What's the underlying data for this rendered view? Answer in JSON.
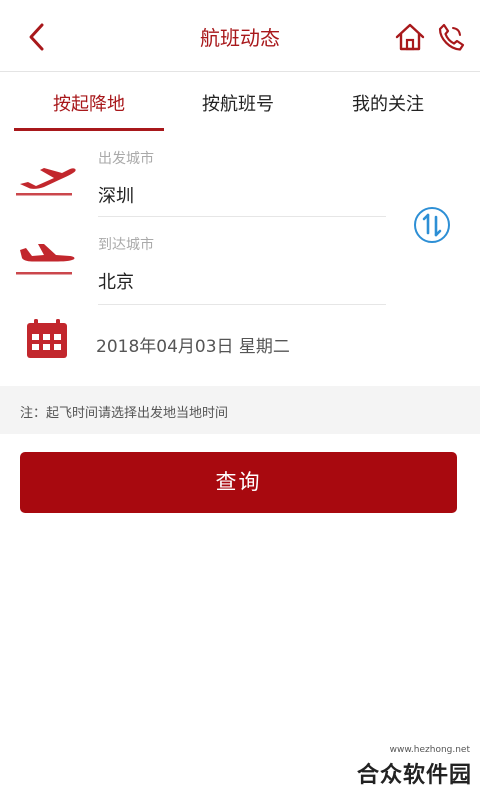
{
  "header": {
    "title": "航班动态",
    "back_icon": "chevron-left-icon",
    "home_icon": "home-icon",
    "phone_icon": "phone-icon"
  },
  "tabs": [
    {
      "label": "按起降地",
      "active": true
    },
    {
      "label": "按航班号",
      "active": false
    },
    {
      "label": "我的关注",
      "active": false
    }
  ],
  "departure": {
    "label": "出发城市",
    "value": "深圳",
    "icon": "plane-takeoff-icon"
  },
  "arrival": {
    "label": "到达城市",
    "value": "北京",
    "icon": "plane-landing-icon"
  },
  "swap_icon": "swap-arrows-icon",
  "date": {
    "icon": "calendar-icon",
    "value": "2018年04月03日 星期二"
  },
  "notice": "注：起飞时间请选择出发地当地时间",
  "query_button": "查询",
  "watermark": {
    "url": "www.hezhong.net",
    "name": "合众软件园"
  },
  "colors": {
    "brand": "#a8181b",
    "button": "#a8090f",
    "swap": "#2d8fd5"
  }
}
